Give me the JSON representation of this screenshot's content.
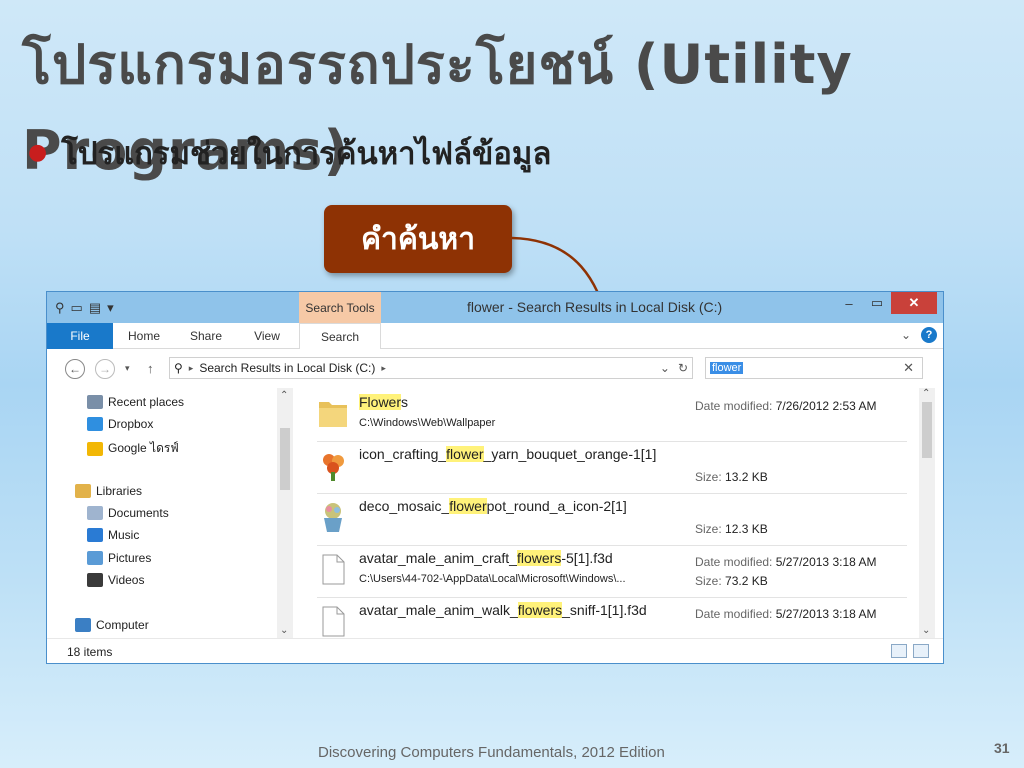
{
  "slide": {
    "title": "โปรแกรมอรรถประโยชน์ (Utility Programs)",
    "bullet": "โปรแกรมช่วยในการค้นหาไฟล์ข้อมูล",
    "callout": "คำค้นหา",
    "footer": "Discovering Computers Fundamentals, 2012 Edition",
    "page_number": "31"
  },
  "window": {
    "title": "flower - Search Results in Local Disk (C:)",
    "context_tab": "Search Tools",
    "ribbon_tabs": [
      "File",
      "Home",
      "Share",
      "View",
      "Search"
    ],
    "address": "Search Results in Local Disk (C:)",
    "search_value": "flower",
    "status": "18 items",
    "nav": [
      {
        "label": "Recent places",
        "icon": "recent-places-icon",
        "color": "#7a8fa8"
      },
      {
        "label": "Dropbox",
        "icon": "dropbox-icon",
        "color": "#2f8fe0"
      },
      {
        "label": "Google ไดรฟ์",
        "icon": "google-drive-icon",
        "color": "#f2b705"
      },
      {
        "label": "Libraries",
        "icon": "libraries-icon",
        "color": "#e2b24a"
      },
      {
        "label": "Documents",
        "icon": "documents-icon",
        "color": "#9fb4cf"
      },
      {
        "label": "Music",
        "icon": "music-icon",
        "color": "#2a7bd4"
      },
      {
        "label": "Pictures",
        "icon": "pictures-icon",
        "color": "#5a9bd6"
      },
      {
        "label": "Videos",
        "icon": "videos-icon",
        "color": "#3a3a3a"
      },
      {
        "label": "Computer",
        "icon": "computer-icon",
        "color": "#3b7fc4"
      }
    ],
    "results": [
      {
        "pre": "",
        "match": "Flower",
        "post": "s",
        "sub": "C:\\Windows\\Web\\Wallpaper",
        "meta1_label": "Date modified:",
        "meta1_value": "7/26/2012 2:53 AM",
        "meta2_label": "",
        "meta2_value": "",
        "icon": "folder-icon"
      },
      {
        "pre": "icon_crafting_",
        "match": "flower",
        "post": "_yarn_bouquet_orange-1[1]",
        "sub": "",
        "meta1_label": "",
        "meta1_value": "",
        "meta2_label": "Size:",
        "meta2_value": "13.2 KB",
        "icon": "flower-image-icon"
      },
      {
        "pre": "deco_mosaic_",
        "match": "flower",
        "post": "pot_round_a_icon-2[1]",
        "sub": "",
        "meta1_label": "",
        "meta1_value": "",
        "meta2_label": "Size:",
        "meta2_value": "12.3 KB",
        "icon": "flowerpot-image-icon"
      },
      {
        "pre": "avatar_male_anim_craft_",
        "match": "flowers",
        "post": "-5[1].f3d",
        "sub": "C:\\Users\\44-702-\\AppData\\Local\\Microsoft\\Windows\\...",
        "meta1_label": "Date modified:",
        "meta1_value": "5/27/2013 3:18 AM",
        "meta2_label": "Size:",
        "meta2_value": "73.2 KB",
        "icon": "file-icon"
      },
      {
        "pre": "avatar_male_anim_walk_",
        "match": "flowers",
        "post": "_sniff-1[1].f3d",
        "sub": "",
        "meta1_label": "Date modified:",
        "meta1_value": "5/27/2013 3:18 AM",
        "meta2_label": "",
        "meta2_value": "",
        "icon": "file-icon"
      }
    ]
  }
}
